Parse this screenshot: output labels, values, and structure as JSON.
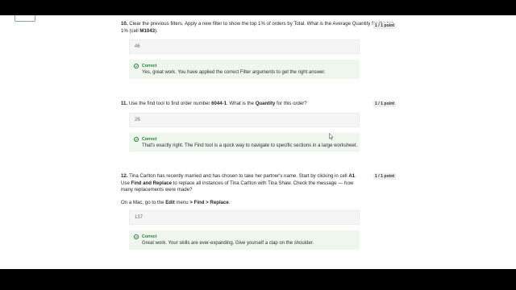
{
  "questions": [
    {
      "number": "10.",
      "text_a": "Clear the previous filters. Apply a new filter to show the top 1% of orders by Total. What is the Average Quantity for the top 1% (cell ",
      "text_b": "M1043",
      "text_c": ").",
      "points": "1 / 1 point",
      "answer": "46",
      "feedback_title": "Correct",
      "feedback_text": "Yes, great work. You have applied the correct Filter arguments to get the right answer."
    },
    {
      "number": "11.",
      "text_a": "Use the find tool to find order number ",
      "text_b": "6044-1",
      "text_c": ". What is the ",
      "text_d": "Quantity",
      "text_e": " for this order?",
      "points": "1 / 1 point",
      "answer": "26",
      "feedback_title": "Correct",
      "feedback_text": "That's exactly right. The Find tool is a quick way to navigate to specific sections in a large worksheet."
    },
    {
      "number": "12.",
      "text_a": "Tina Carlton has recently married and has chosen to take her partner's name. Start by clicking in cell ",
      "text_b": "A1",
      "text_c": ". Use ",
      "text_d": "Find and Replace",
      "text_e": " to replace all instances of Tina Carlton with Tina Shaw. Check the message — how many replacements were made?",
      "note_a": "On a Mac, go to the ",
      "note_b": "Edit",
      "note_c": " menu ",
      "note_d": "> Find > Replace",
      "note_e": ".",
      "points": "1 / 1 point",
      "answer": "137",
      "feedback_title": "Correct",
      "feedback_text": "Great work. Your skills are ever-expanding. Give yourself a clap on the shoulder."
    }
  ],
  "icons": {
    "check": "check-circle-icon",
    "cursor": "mouse-pointer-icon"
  },
  "colors": {
    "correct_green": "#1b7f2f",
    "feedback_bg": "#eef6ee",
    "answer_bg": "#f5f5f5",
    "points_bg": "#ededed"
  }
}
